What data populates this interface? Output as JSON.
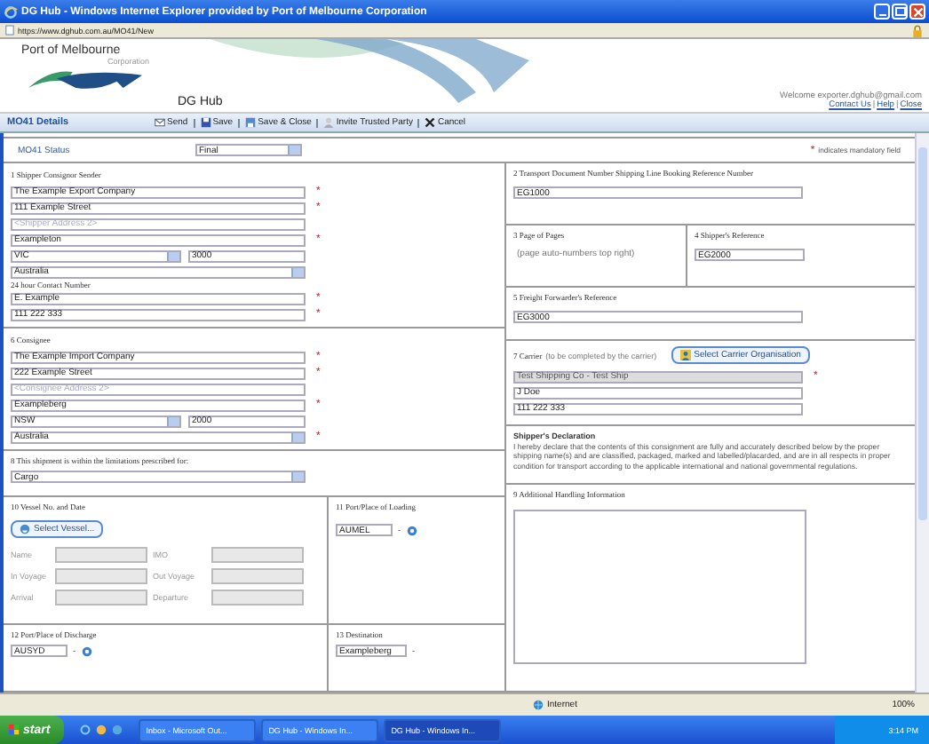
{
  "window": {
    "title": "DG Hub - Windows Internet Explorer provided by Port of Melbourne Corporation",
    "url": "https://www.dghub.com.au/MO41/New"
  },
  "header": {
    "logo": "Port of Melbourne",
    "logo_sub": "Corporation",
    "app": "DG Hub",
    "welcome": "Welcome exporter.dghub@gmail.com",
    "links": [
      {
        "kind": "link",
        "label": "Contact Us"
      },
      {
        "kind": "separator",
        "label": "|"
      },
      {
        "kind": "link",
        "label": "Help"
      },
      {
        "kind": "separator",
        "label": "|"
      },
      {
        "kind": "link",
        "label": "Close"
      }
    ]
  },
  "toolbar": {
    "title": "MO41 Details",
    "actions": [
      {
        "label": "Send",
        "kind": "send"
      },
      {
        "label": "Save",
        "kind": "save"
      },
      {
        "label": "Save & Close",
        "kind": "saveclose"
      },
      {
        "label": "Invite Trusted Party",
        "kind": "invite"
      },
      {
        "label": "Cancel",
        "kind": "cancel"
      }
    ]
  },
  "status": {
    "label": "MO41 Status",
    "value": "Final",
    "mandatory_mark": "*",
    "mandatory_note": "indicates mandatory field"
  },
  "shipper": {
    "title": "1 Shipper Consignor Sender",
    "fields": [
      {
        "kind": "text",
        "value": "The Example Export Company",
        "mark": "*"
      },
      {
        "kind": "text",
        "value": "111 Example Street",
        "mark": "*"
      },
      {
        "kind": "text",
        "placeholder": "<Shipper Address 2>"
      },
      {
        "kind": "text",
        "value": "Exampleton",
        "mark": "*"
      },
      {
        "kind": "pair",
        "state": "VIC",
        "postcode": "3000"
      },
      {
        "kind": "select",
        "value": "Australia"
      },
      {
        "kind": "label",
        "value": "24 hour Contact Number"
      },
      {
        "kind": "text",
        "value": "E. Example",
        "mark": "*"
      },
      {
        "kind": "text",
        "value": "111 222 333",
        "mark": "*"
      }
    ]
  },
  "consignee": {
    "title": "6 Consignee",
    "fields": [
      {
        "kind": "text",
        "value": "The Example Import Company",
        "mark": "*"
      },
      {
        "kind": "text",
        "value": "222 Example Street",
        "mark": "*"
      },
      {
        "kind": "text",
        "placeholder": "<Consignee Address 2>"
      },
      {
        "kind": "text",
        "value": "Exampleberg",
        "mark": "*"
      },
      {
        "kind": "pair",
        "state": "NSW",
        "postcode": "2000"
      },
      {
        "kind": "select",
        "value": "Australia",
        "mark": "*"
      }
    ]
  },
  "limitations": {
    "title": "8 This shipment is within the limitations prescribed for:",
    "value": "Cargo"
  },
  "vessel": {
    "title": "10 Vessel No. and Date",
    "button": "Select Vessel...",
    "fields": [
      {
        "label": "Name",
        "disabled": true
      },
      {
        "label": "IMO",
        "disabled": true
      },
      {
        "label": "In Voyage",
        "disabled": true
      },
      {
        "label": "Out Voyage",
        "disabled": true
      },
      {
        "label": "Arrival",
        "disabled": true
      },
      {
        "label": "Departure",
        "disabled": true
      }
    ]
  },
  "loading": {
    "title": "11 Port/Place of Loading",
    "value": "AUMEL",
    "dash": "-"
  },
  "discharge": {
    "title": "12 Port/Place of Discharge",
    "value": "AUSYD",
    "dash": "-"
  },
  "destination": {
    "title": "13 Destination",
    "value": "Exampleberg",
    "dash": "-"
  },
  "transport_doc": {
    "title": "2 Transport Document Number Shipping Line Booking Reference Number",
    "value": "EG1000"
  },
  "pages": {
    "title": "3 Page of Pages",
    "note": "(page auto-numbers top right)"
  },
  "shipper_ref": {
    "title": "4 Shipper's Reference",
    "value": "EG2000"
  },
  "forwarder_ref": {
    "title": "5 Freight Forwarder's Reference",
    "value": "EG3000"
  },
  "carrier": {
    "title": "7 Carrier",
    "note": "(to be completed by the carrier)",
    "button": "Select Carrier Organisation",
    "fields": [
      {
        "value": "Test Shipping Co - Test Ship",
        "disabled": true,
        "mark": "*"
      },
      {
        "value": "J Doe",
        "disabled": false
      },
      {
        "value": "111 222 333",
        "disabled": false
      }
    ]
  },
  "declaration": {
    "title": "Shipper's Declaration",
    "text": "I hereby declare that the contents of this consignment are fully and accurately described below by the proper shipping name(s) and are classified, packaged, marked and labelled/placarded, and are in all respects in proper condition for transport according to the applicable international and national governmental regulations."
  },
  "handling": {
    "title": "9 Additional Handling Information"
  },
  "ie_status": {
    "zone": "Internet",
    "zoom": "100%"
  },
  "taskbar": {
    "start": "start",
    "tasks": [
      {
        "label": "Inbox - Microsoft Out...",
        "selected": false
      },
      {
        "label": "DG Hub - Windows In...",
        "selected": false
      },
      {
        "label": "DG Hub - Windows In...",
        "selected": true
      }
    ],
    "clock": "3:14 PM"
  }
}
